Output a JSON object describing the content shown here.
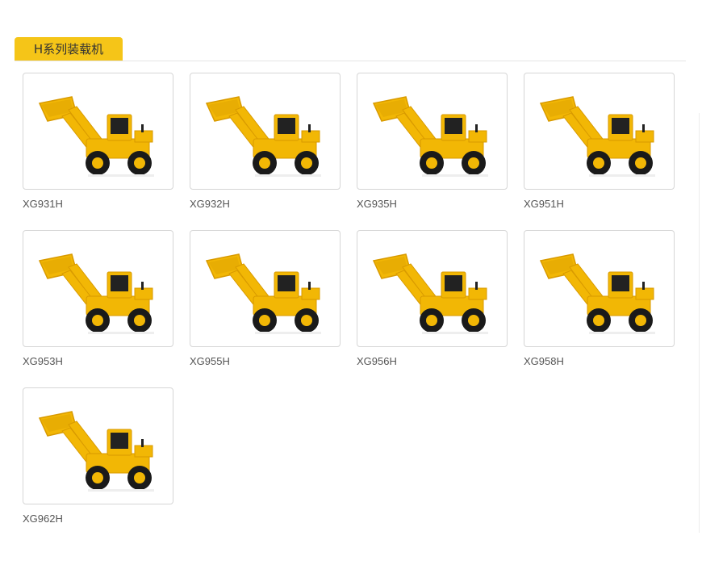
{
  "section": {
    "title": "H系列装载机"
  },
  "colors": {
    "accent": "#f5c518",
    "machine": "#f2b705",
    "machine_dark": "#d89a00",
    "tire": "#1a1a1a",
    "cab": "#222222"
  },
  "products": [
    {
      "name": "XG931H",
      "icon": "wheel-loader-icon"
    },
    {
      "name": "XG932H",
      "icon": "wheel-loader-icon"
    },
    {
      "name": "XG935H",
      "icon": "wheel-loader-icon"
    },
    {
      "name": "XG951H",
      "icon": "wheel-loader-icon"
    },
    {
      "name": "XG953H",
      "icon": "wheel-loader-icon"
    },
    {
      "name": "XG955H",
      "icon": "wheel-loader-icon"
    },
    {
      "name": "XG956H",
      "icon": "wheel-loader-icon"
    },
    {
      "name": "XG958H",
      "icon": "wheel-loader-icon"
    },
    {
      "name": "XG962H",
      "icon": "wheel-loader-icon"
    }
  ]
}
